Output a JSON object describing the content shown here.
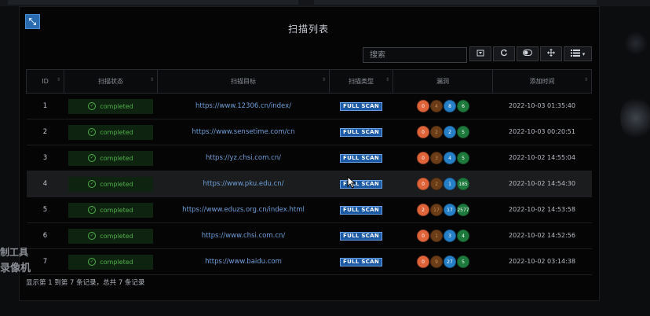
{
  "panel": {
    "title": "扫描列表",
    "search_placeholder": "搜索"
  },
  "toolbar": [
    {
      "name": "export-button",
      "icon": "export-icon",
      "glyph": "⏷"
    },
    {
      "name": "refresh-button",
      "icon": "refresh-icon",
      "glyph": "⟳"
    },
    {
      "name": "toggle-button",
      "icon": "toggle-icon",
      "glyph": "⊖"
    },
    {
      "name": "move-button",
      "icon": "move-icon",
      "glyph": "✥"
    },
    {
      "name": "columns-button",
      "icon": "columns-icon",
      "glyph": "☰▾"
    }
  ],
  "table": {
    "headers": [
      "ID",
      "扫描状态",
      "扫描目标",
      "扫描类型",
      "漏洞",
      "添加时间"
    ],
    "rows": [
      {
        "id": "1",
        "status": "completed",
        "target": "https://www.12306.cn/index/",
        "type": "FULL SCAN",
        "vulns": [
          "0",
          "4",
          "8",
          "6"
        ],
        "time": "2022-10-03 01:35:40"
      },
      {
        "id": "2",
        "status": "completed",
        "target": "https://www.sensetime.com/cn",
        "type": "FULL SCAN",
        "vulns": [
          "0",
          "2",
          "2",
          "5"
        ],
        "time": "2022-10-03 00:20:51"
      },
      {
        "id": "3",
        "status": "completed",
        "target": "https://yz.chsi.com.cn/",
        "type": "FULL SCAN",
        "vulns": [
          "0",
          "3",
          "4",
          "5"
        ],
        "time": "2022-10-02 14:55:04"
      },
      {
        "id": "4",
        "status": "completed",
        "target": "https://www.pku.edu.cn/",
        "type": "FULL SCAN",
        "vulns": [
          "0",
          "2",
          "1",
          "185"
        ],
        "time": "2022-10-02 14:54:30"
      },
      {
        "id": "5",
        "status": "completed",
        "target": "https://www.eduzs.org.cn/index.html",
        "type": "FULL SCAN",
        "vulns": [
          "2",
          "17",
          "17",
          "2577"
        ],
        "time": "2022-10-02 14:53:58"
      },
      {
        "id": "6",
        "status": "completed",
        "target": "https://www.chsi.com.cn/",
        "type": "FULL SCAN",
        "vulns": [
          "0",
          "1",
          "3",
          "4"
        ],
        "time": "2022-10-02 14:52:56"
      },
      {
        "id": "7",
        "status": "completed",
        "target": "https://www.baidu.com",
        "type": "FULL SCAN",
        "vulns": [
          "0",
          "9",
          "27",
          "5"
        ],
        "time": "2022-10-02 03:14:38"
      }
    ],
    "highlighted_row": "4"
  },
  "footer": {
    "summary": "显示第 1 到第 7 条记录，总共 7 条记录"
  },
  "watermark": {
    "line1": "制工具",
    "line2": "录像机"
  },
  "colors": {
    "accent": "#2a6bb0",
    "completed_text": "#4fae4a",
    "completed_bg": "#0f2410",
    "link": "#6f9fd8",
    "vuln_high": "#e0643a",
    "vuln_medium": "#6a3d18",
    "vuln_low": "#2680c8",
    "vuln_info": "#1e7a3c"
  }
}
